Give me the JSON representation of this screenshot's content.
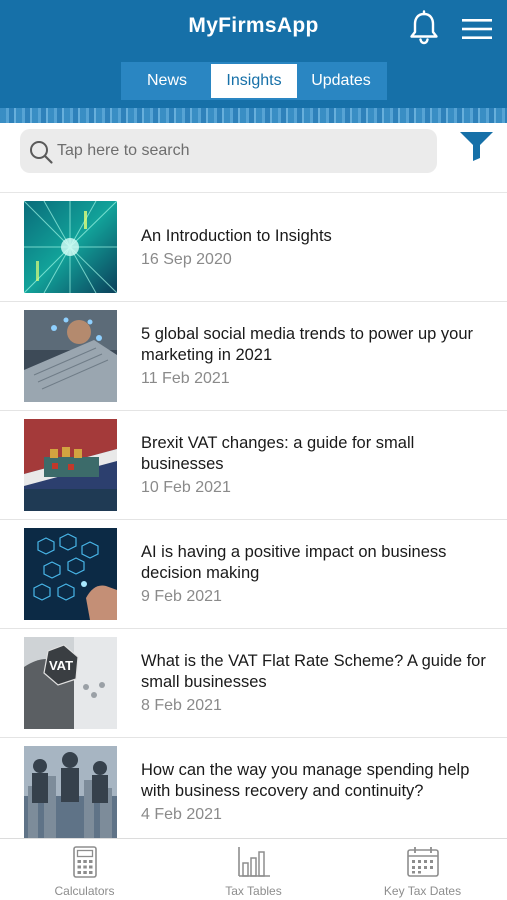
{
  "app": {
    "title": "MyFirmsApp"
  },
  "header_icons": {
    "notifications": "bell-icon",
    "menu": "hamburger-menu-icon"
  },
  "tabs": [
    {
      "label": "News",
      "selected": false
    },
    {
      "label": "Insights",
      "selected": true
    },
    {
      "label": "Updates",
      "selected": false
    }
  ],
  "search": {
    "placeholder": "Tap here to search",
    "value": ""
  },
  "filter": {
    "icon": "filter-icon",
    "color": "#1670a8"
  },
  "articles": [
    {
      "title": "An Introduction to Insights",
      "date": "16 Sep 2020"
    },
    {
      "title": "5 global social media trends to power up your marketing in 2021",
      "date": "11 Feb 2021"
    },
    {
      "title": "Brexit VAT changes: a guide for small businesses",
      "date": "10 Feb 2021"
    },
    {
      "title": "AI is having a positive impact on business decision making",
      "date": "9 Feb 2021"
    },
    {
      "title": "What is the VAT Flat Rate Scheme? A guide for small businesses",
      "date": "8 Feb 2021"
    },
    {
      "title": "How can the way you manage spending help with business recovery and continuity?",
      "date": "4 Feb 2021"
    }
  ],
  "bottom_nav": [
    {
      "label": "Calculators",
      "icon": "calculator-icon"
    },
    {
      "label": "Tax Tables",
      "icon": "bar-chart-icon"
    },
    {
      "label": "Key Tax Dates",
      "icon": "calendar-icon"
    }
  ],
  "colors": {
    "brand": "#1670a8",
    "selected_tab_bg": "#ffffff",
    "muted_text": "#8a8a8a"
  }
}
